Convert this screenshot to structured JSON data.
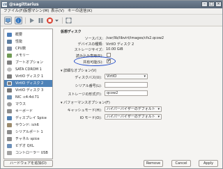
{
  "window": {
    "title": "@sagittarius",
    "minimize_symbol": "–",
    "maximize_symbol": "□",
    "close_symbol": "×"
  },
  "menubar": [
    "ファイル(F)",
    "仮想マシン(M)",
    "表示(V)",
    "キーの送信(K)"
  ],
  "toolbar": {
    "icons": [
      "monitor-icon",
      "info-icon",
      "play-icon",
      "pause-icon",
      "stop-icon",
      "dropdown-icon",
      "fullscreen-icon"
    ]
  },
  "sidebar": {
    "items": [
      {
        "label": "概要",
        "icon": "overview-icon",
        "color": "#4d7eb8"
      },
      {
        "label": "性能",
        "icon": "performance-icon",
        "color": "#5d7d9f"
      },
      {
        "label": "CPU数",
        "icon": "cpu-icon",
        "color": "#7c8aa0"
      },
      {
        "label": "メモリー",
        "icon": "memory-icon",
        "color": "#6f9a54"
      },
      {
        "label": "ブートオプション",
        "icon": "boot-icon",
        "color": "#808080"
      },
      {
        "label": "SATA CDROM 1",
        "icon": "cdrom-icon",
        "color": "#bfbfbf"
      },
      {
        "label": "VirtIO ディスク 1",
        "icon": "disk-icon",
        "color": "#7a7a7a"
      },
      {
        "label": "VirtIO ディスク 2",
        "icon": "disk-icon",
        "color": "#7a7a7a",
        "selected": true
      },
      {
        "label": "VirtIO ディスク 3",
        "icon": "disk-icon",
        "color": "#7a7a7a"
      },
      {
        "label": "NIC :c4:4d:71",
        "icon": "nic-icon",
        "color": "#6b8fb2"
      },
      {
        "label": "マウス",
        "icon": "mouse-icon",
        "color": "#a0a0a0"
      },
      {
        "label": "キーボード",
        "icon": "keyboard-icon",
        "color": "#8d8d8d"
      },
      {
        "label": "ディスプレイ Spice",
        "icon": "display-icon",
        "color": "#4f7fb1"
      },
      {
        "label": "サウンド: ich6",
        "icon": "sound-icon",
        "color": "#9b8b6d"
      },
      {
        "label": "シリアルポート 1",
        "icon": "serial-icon",
        "color": "#8c8c8c"
      },
      {
        "label": "チャネル spice",
        "icon": "channel-icon",
        "color": "#8c8c8c"
      },
      {
        "label": "ビデオ QXL",
        "icon": "video-icon",
        "color": "#6c8fb8"
      },
      {
        "label": "コントローラー USB",
        "icon": "controller-icon",
        "color": "#a3a3a3"
      }
    ],
    "add_hardware": "ハードウェアを追加(D)"
  },
  "disk": {
    "section_title": "仮想ディスク",
    "source_path_label": "ソースパス:",
    "source_path": "/var/lib/libvirt/images/cfs2.qcow2",
    "device_type_label": "デバイスの種類:",
    "device_type": "VirtIO ディスク 2",
    "storage_size_label": "ストレージサイズ:",
    "storage_size": "10.00 GiB",
    "readonly_label": "読み込み専用(R):",
    "shareable_label": "共有可能(S):"
  },
  "advanced": {
    "section_title": "詳細なオプション(V)",
    "disk_bus_label": "ディスクバス(U):",
    "disk_bus": "VirtIO",
    "serial_label": "シリアル番号(L):",
    "serial": "",
    "storage_format_label": "ストレージの形式(T):",
    "storage_format": "qcow2"
  },
  "performance": {
    "section_title": "パフォーマンスオプション(F)",
    "cache_mode_label": "キャッシュモード(H):",
    "cache_mode": "ハイパーバイザーのデフォルト",
    "io_mode_label": "IO モード(O):",
    "io_mode": "ハイパーバイザーのデフォルト"
  },
  "buttons": {
    "remove": "Remove",
    "cancel": "Cancel",
    "apply": "Apply"
  },
  "colors": {
    "selection": "#4f83b8",
    "annotation": "#1f49c8"
  }
}
